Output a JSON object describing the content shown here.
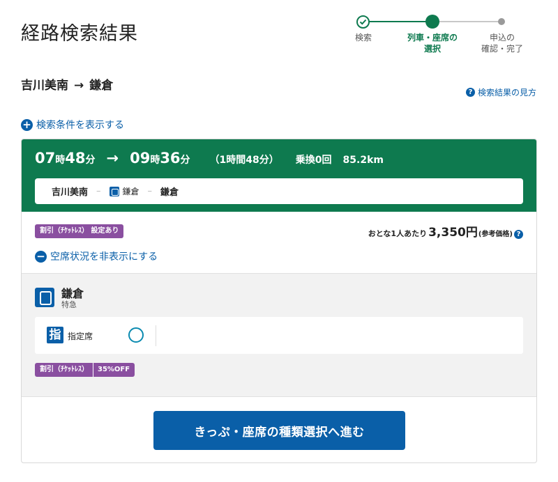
{
  "page": {
    "title": "経路検索結果"
  },
  "stepper": {
    "steps": [
      {
        "label_line1": "検索",
        "label_line2": "",
        "state": "done"
      },
      {
        "label_line1": "列車・座席の",
        "label_line2": "選択",
        "state": "current"
      },
      {
        "label_line1": "申込の",
        "label_line2": "確認・完了",
        "state": "todo"
      }
    ]
  },
  "route": {
    "from": "吉川美南",
    "arrow": "→",
    "to": "鎌倉"
  },
  "help_link": {
    "icon": "question-icon",
    "label": "検索結果の見方"
  },
  "conditions_toggle": {
    "icon": "plus-circle-icon",
    "label": "検索条件を表示する"
  },
  "result": {
    "depart_hour": "07",
    "depart_hour_unit": "時",
    "depart_min": "48",
    "depart_min_unit": "分",
    "arrow": "→",
    "arrive_hour": "09",
    "arrive_hour_unit": "時",
    "arrive_min": "36",
    "arrive_min_unit": "分",
    "duration": "（1時間48分）",
    "transfers": "乗換0回",
    "distance": "85.2km",
    "route_bar": {
      "from": "吉川美南",
      "dash": "–",
      "train_name": "鎌倉",
      "to": "鎌倉"
    },
    "discount_badge": {
      "part1": "割引（ﾁｹｯﾄﾚｽ）",
      "part2": "設定あり"
    },
    "price": {
      "label": "おとな1人あたり",
      "value": "3,350円",
      "note": "(参考価格)"
    },
    "seat_toggle": {
      "icon": "minus-circle-icon",
      "label": "空席状況を非表示にする"
    },
    "train": {
      "name": "鎌倉",
      "type": "特急",
      "seat": {
        "icon_char": "指",
        "label": "指定席",
        "availability": "○"
      },
      "discount": {
        "part1": "割引（ﾁｹｯﾄﾚｽ）",
        "part2": "35%OFF"
      }
    },
    "cta_label": "きっぷ・座席の種類選択へ進む"
  },
  "colors": {
    "header_green": "#0e7a4f",
    "link_blue": "#0a5fa8",
    "badge_purple": "#8a4fa0",
    "availability_teal": "#0a8ab0"
  }
}
